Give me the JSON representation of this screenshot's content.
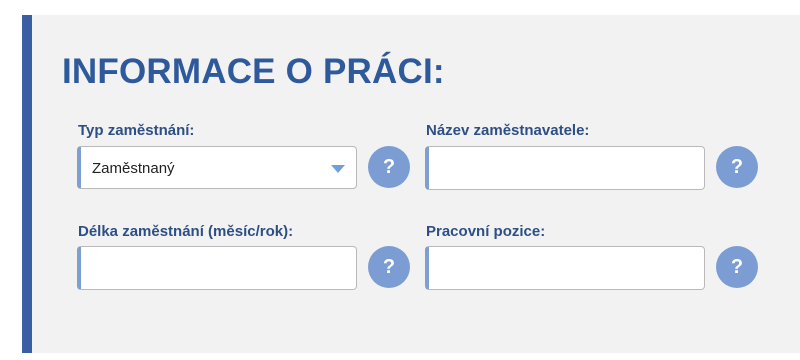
{
  "section": {
    "title": "INFORMACE O PRÁCI:"
  },
  "fields": {
    "employment_type": {
      "label": "Typ zaměstnání:",
      "value": "Zaměstnaný"
    },
    "employer_name": {
      "label": "Název zaměstnavatele:",
      "value": ""
    },
    "employment_length": {
      "label": "Délka zaměstnání (měsíc/rok):",
      "value": ""
    },
    "job_position": {
      "label": "Pracovní pozice:",
      "value": ""
    }
  },
  "help_button": {
    "label": "?"
  },
  "icons": {
    "dropdown": "chevron-down-icon",
    "help": "question-icon"
  },
  "colors": {
    "accent": "#3a5ea4",
    "title": "#2e5a9b",
    "label": "#2e4f86",
    "help_bg": "#7b9dd3",
    "panel_bg": "#f2f2f2"
  }
}
